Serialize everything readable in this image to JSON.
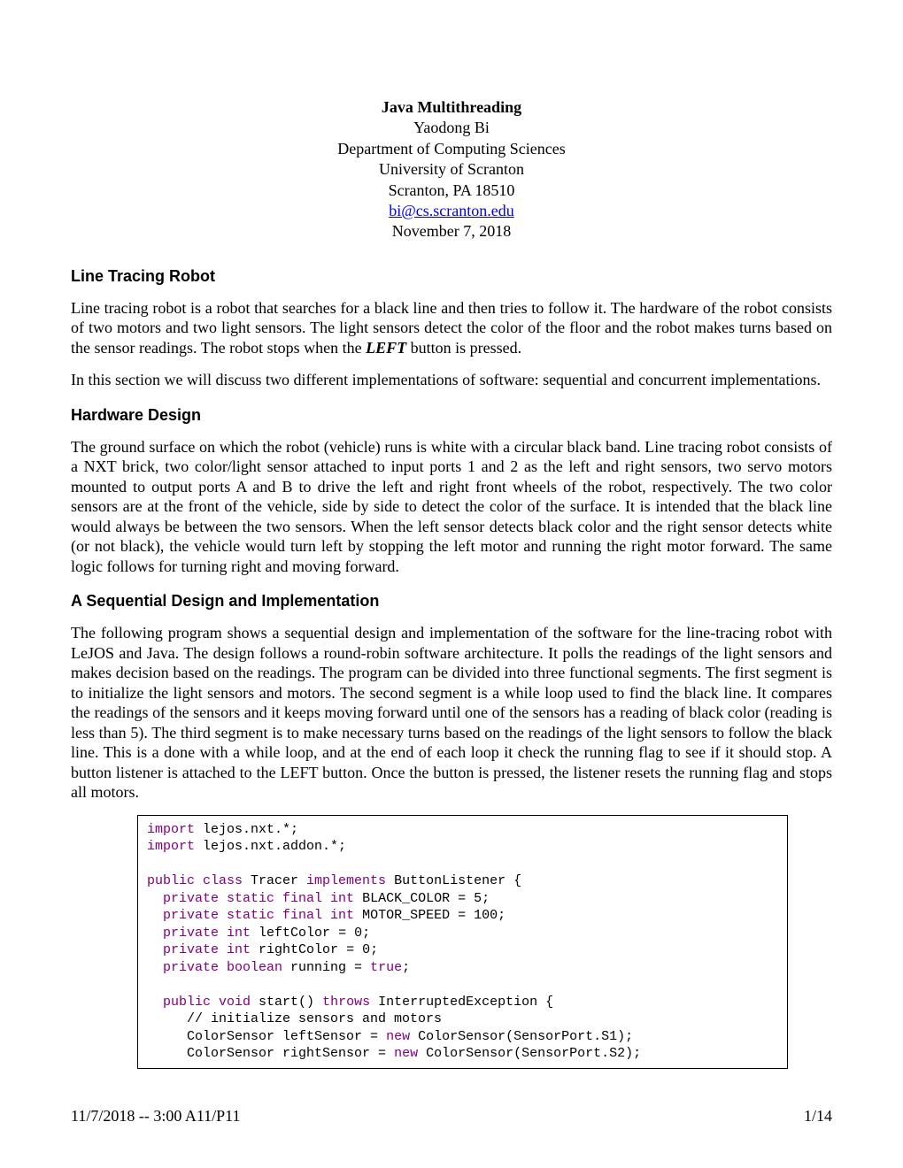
{
  "header": {
    "title": "Java Multithreading",
    "author": "Yaodong Bi",
    "department": "Department of Computing Sciences",
    "university": "University of Scranton",
    "city_state": "Scranton, PA 18510",
    "email": "bi@cs.scranton.edu",
    "date": "November 7, 2018"
  },
  "sections": {
    "s1_heading": "Line Tracing Robot",
    "s1_p1_a": "Line tracing robot is a robot that searches for a black line and then tries to follow it. The hardware of the robot consists of two motors and two light sensors. The light sensors detect the color of the floor and the robot makes turns based on the sensor readings. The robot stops when the ",
    "s1_p1_b": "LEFT",
    "s1_p1_c": " button is pressed.",
    "s1_p2": "In this section we will discuss two different implementations of software: sequential and concurrent implementations.",
    "s2_heading": "Hardware Design",
    "s2_p1": "The ground surface on which the robot (vehicle) runs is white with a circular black band. Line tracing robot consists of a NXT brick, two color/light sensor attached to input ports 1 and 2 as the left and right sensors, two servo motors mounted to output ports A and B to drive the left and right front wheels of the robot, respectively. The two color sensors are at the front of the vehicle, side by side to detect the color of the surface. It is intended that the black line would always be between the two sensors. When the left sensor detects black color and the right sensor detects white (or not black), the vehicle would turn left by stopping the left motor and running the right motor forward. The same logic follows for turning right and moving forward.",
    "s3_heading": "A Sequential Design and Implementation",
    "s3_p1": "The following program shows a sequential design and implementation of the software for the line-tracing robot with LeJOS and Java. The design follows a round-robin software architecture. It polls the readings of the light sensors and makes decision based on the readings. The program can be divided into three functional segments. The first segment is to initialize the light sensors and motors. The second segment is a while loop used to find the black line. It compares the readings of the sensors and it keeps moving forward until one of the sensors has a reading of black color (reading is less than 5).  The third segment is to make necessary turns based on the readings of the light sensors to follow the black line.  This is a done with a while loop, and at the end of each loop it check the running flag to see if it should stop. A button listener is attached to the LEFT button. Once the button is pressed, the listener resets the running flag and stops all motors."
  },
  "code": {
    "l1_kw": "import",
    "l1_rest": " lejos.nxt.*;",
    "l2_kw": "import",
    "l2_rest": " lejos.nxt.addon.*;",
    "l3_kw1": "public class",
    "l3_name": " Tracer ",
    "l3_kw2": "implements",
    "l3_rest": " ButtonListener {",
    "l4_kw": "private static final int",
    "l4_rest": " BLACK_COLOR = 5;",
    "l5_kw": "private static final int",
    "l5_rest": " MOTOR_SPEED = 100;",
    "l6_kw": "private int",
    "l6_rest": " leftColor = 0;",
    "l7_kw": "private int",
    "l7_rest": " rightColor = 0;",
    "l8_kw": "private boolean",
    "l8_mid": " running = ",
    "l8_val": "true",
    "l8_end": ";",
    "l9_kw1": "public void",
    "l9_mid": " start() ",
    "l9_kw2": "throws",
    "l9_rest": " InterruptedException {",
    "l10": "// initialize sensors and motors",
    "l11_a": "ColorSensor leftSensor = ",
    "l11_kw": "new",
    "l11_b": " ColorSensor(SensorPort.S1);",
    "l12_a": "ColorSensor rightSensor = ",
    "l12_kw": "new",
    "l12_b": " ColorSensor(SensorPort.S2);"
  },
  "footer": {
    "left": "11/7/2018 -- 3:00 A11/P11",
    "right": "1/14"
  }
}
